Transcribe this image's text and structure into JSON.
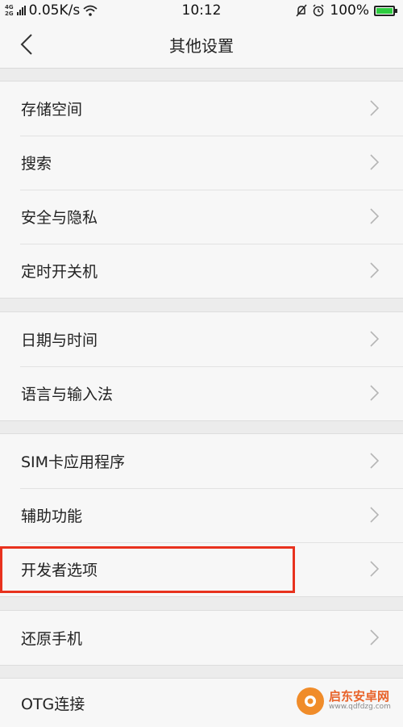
{
  "status_bar": {
    "network_type": "4G 2G",
    "speed": "0.05K/s",
    "time": "10:12",
    "battery": "100%"
  },
  "header": {
    "title": "其他设置"
  },
  "groups": [
    {
      "items": [
        "存储空间",
        "搜索",
        "安全与隐私",
        "定时开关机"
      ]
    },
    {
      "items": [
        "日期与时间",
        "语言与输入法"
      ]
    },
    {
      "items": [
        "SIM卡应用程序",
        "辅助功能",
        "开发者选项"
      ]
    },
    {
      "items": [
        "还原手机"
      ]
    },
    {
      "items": [
        "OTG连接"
      ]
    }
  ],
  "watermark": {
    "name": "启东安卓网",
    "url": "www.qdfdzg.com"
  },
  "colors": {
    "highlight": "#e8321e",
    "battery_fill": "#2ecc40",
    "watermark": "#e8632a"
  }
}
